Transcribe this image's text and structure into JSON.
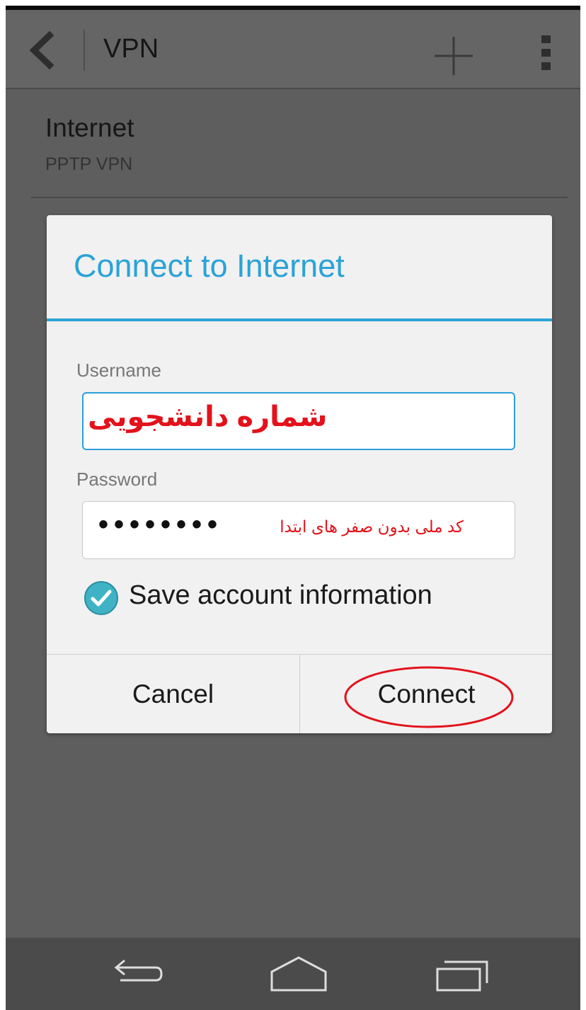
{
  "action_bar": {
    "back_icon": "chevron-left-icon",
    "title": "VPN",
    "add_icon": "plus-icon",
    "menu_icon": "overflow-menu-icon"
  },
  "vpn_list": [
    {
      "name": "Internet",
      "type": "PPTP VPN"
    }
  ],
  "dialog": {
    "title": "Connect to Internet",
    "username": {
      "label": "Username",
      "value": "شماره دانشجویی"
    },
    "password": {
      "label": "Password",
      "masked_value": "••••••••",
      "hint": "کد ملی بدون صفر های ابتدا"
    },
    "save_account": {
      "label": "Save account information",
      "checked": true,
      "icon": "checkmark-circle-icon"
    },
    "buttons": {
      "cancel": "Cancel",
      "connect": "Connect"
    },
    "highlight_color": "#e3121b",
    "accent_color": "#2aa3d6"
  },
  "nav_bar": {
    "back_icon": "nav-back-icon",
    "home_icon": "nav-home-icon",
    "recent_icon": "nav-recent-apps-icon"
  }
}
